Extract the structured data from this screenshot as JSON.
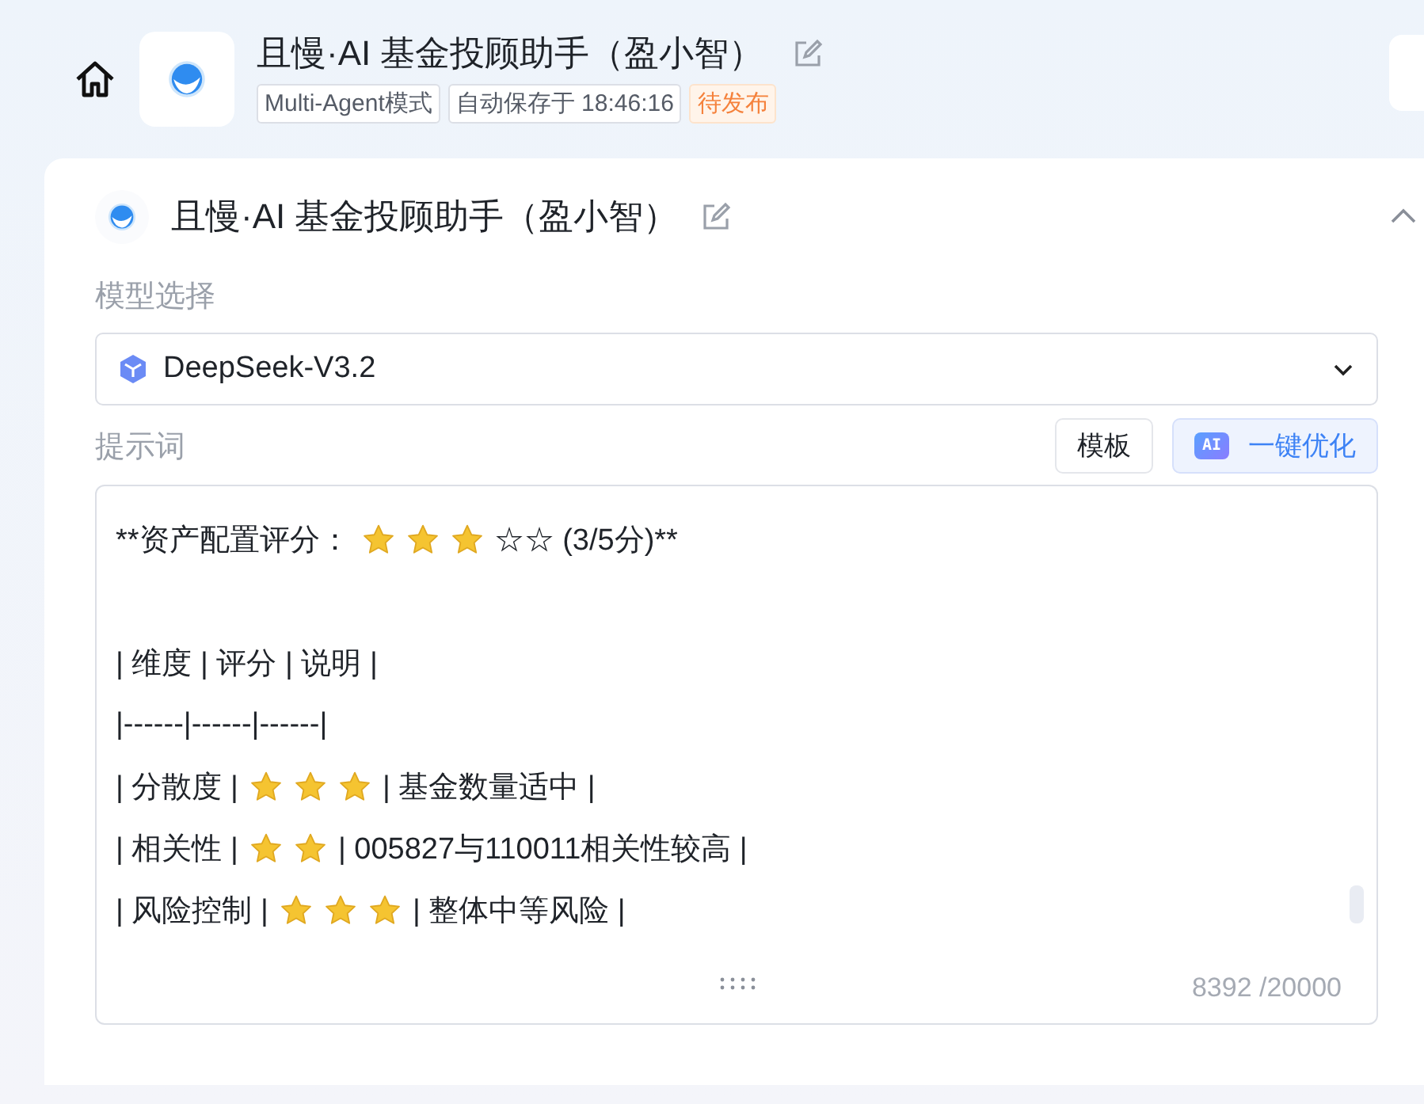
{
  "header": {
    "title": "且慢·AI 基金投顾助手（盈小智）",
    "tags": [
      {
        "text": "Multi-Agent模式",
        "kind": "plain"
      },
      {
        "text": "自动保存于 18:46:16",
        "kind": "plain"
      },
      {
        "text": "待发布",
        "kind": "warning"
      }
    ]
  },
  "agent": {
    "name": "且慢·AI 基金投顾助手（盈小智）",
    "expanded": true
  },
  "model": {
    "label": "模型选择",
    "value": "DeepSeek-V3.2"
  },
  "prompt": {
    "label": "提示词",
    "buttons": [
      {
        "label": "模板",
        "kind": "plain"
      },
      {
        "label": "一键优化",
        "kind": "ai",
        "badge": "AI"
      }
    ],
    "lines": [
      {
        "kind": "text",
        "parts": [
          {
            "kind": "text",
            "text": "**资产配置评分："
          },
          {
            "kind": "star"
          },
          {
            "kind": "star"
          },
          {
            "kind": "star"
          },
          {
            "kind": "text",
            "text": "☆☆ (3/5分)**"
          }
        ]
      },
      {
        "kind": "blank"
      },
      {
        "kind": "text",
        "parts": [
          {
            "kind": "text",
            "text": "| 维度 | 评分 | 说明 |"
          }
        ]
      },
      {
        "kind": "text",
        "parts": [
          {
            "kind": "text",
            "text": "|------|------|------|"
          }
        ]
      },
      {
        "kind": "text",
        "parts": [
          {
            "kind": "text",
            "text": "| 分散度 |"
          },
          {
            "kind": "star"
          },
          {
            "kind": "star"
          },
          {
            "kind": "star"
          },
          {
            "kind": "text",
            "text": "| 基金数量适中 |"
          }
        ]
      },
      {
        "kind": "text",
        "parts": [
          {
            "kind": "text",
            "text": "| 相关性 |"
          },
          {
            "kind": "star"
          },
          {
            "kind": "star"
          },
          {
            "kind": "text",
            "text": "| 005827与110011相关性较高 |"
          }
        ]
      },
      {
        "kind": "text",
        "parts": [
          {
            "kind": "text",
            "text": "| 风险控制 |"
          },
          {
            "kind": "star"
          },
          {
            "kind": "star"
          },
          {
            "kind": "star"
          },
          {
            "kind": "text",
            "text": "| 整体中等风险 |"
          }
        ]
      }
    ],
    "count": "8392 /20000"
  }
}
